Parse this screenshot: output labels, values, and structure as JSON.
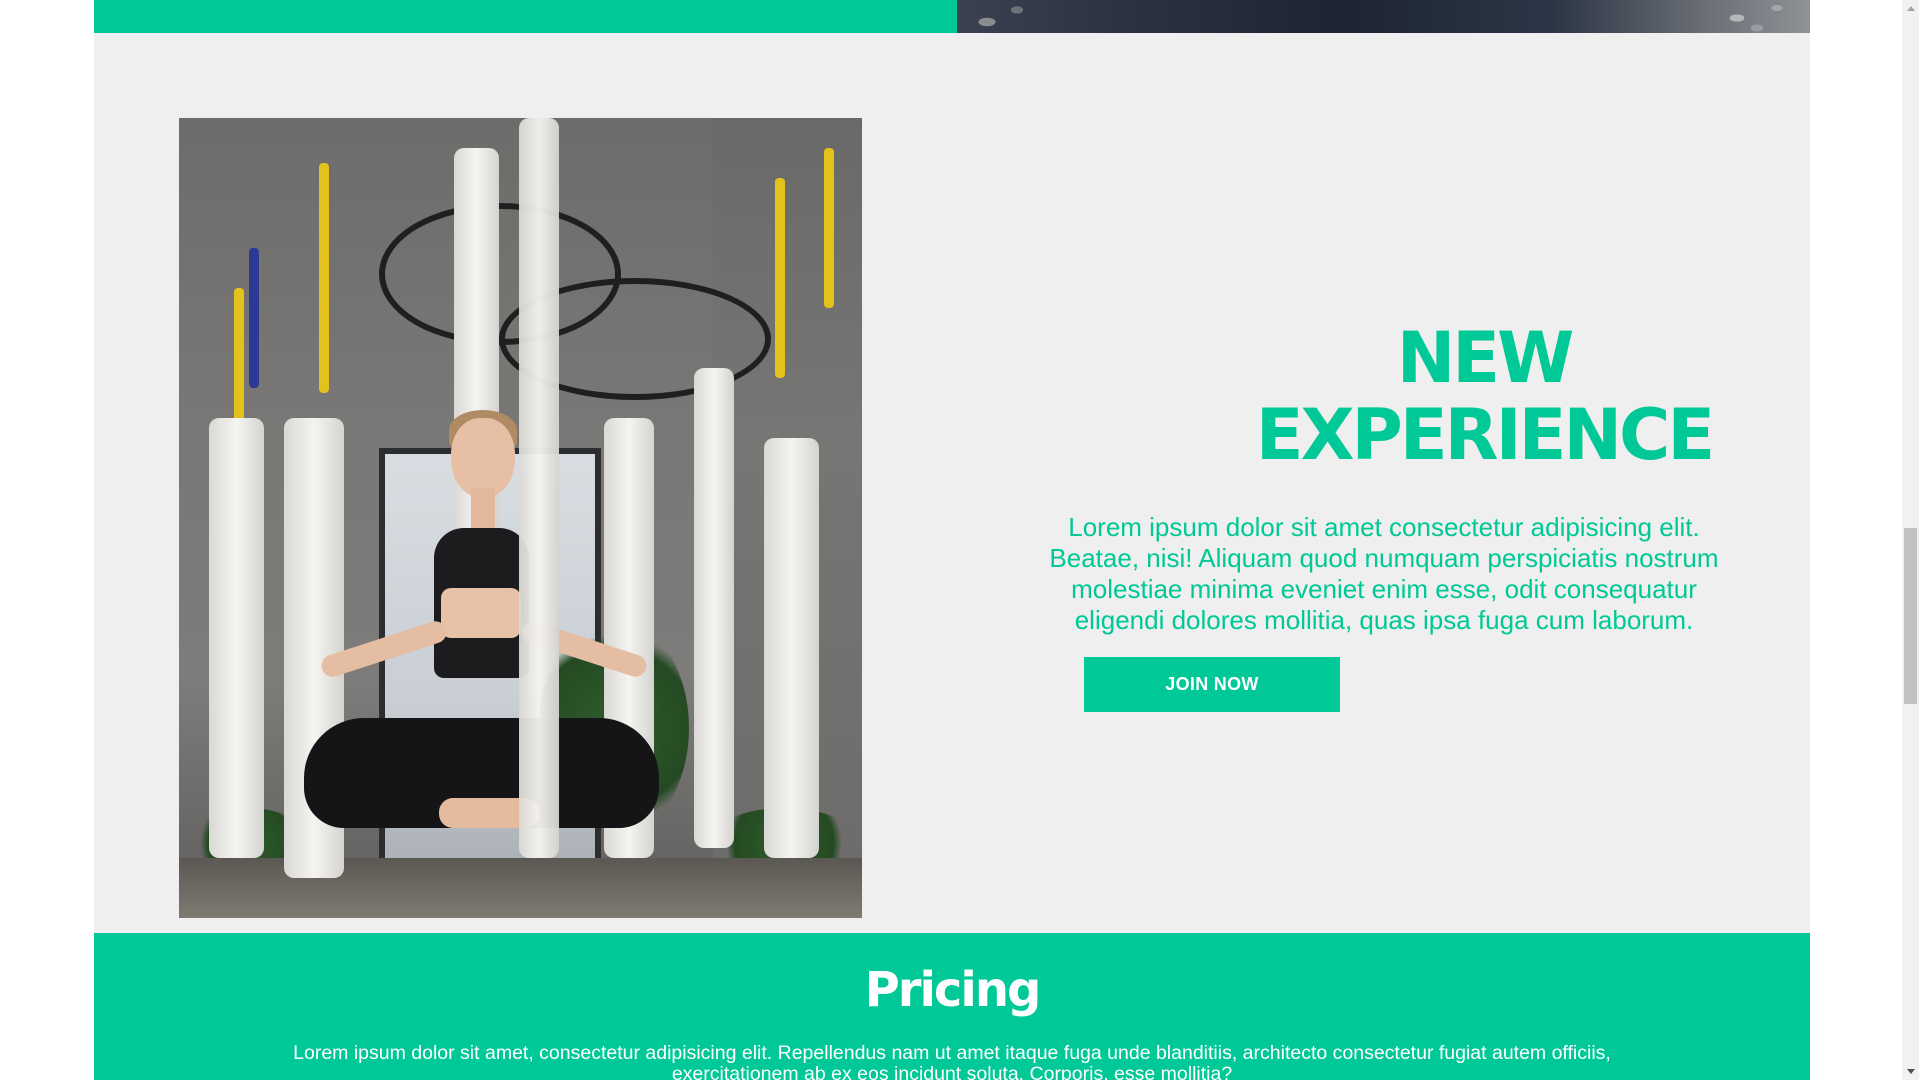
{
  "hero": {
    "title_line1": "NEW",
    "title_line2": "EXPERIENCE",
    "paragraph": "Lorem ipsum dolor sit amet consectetur adipisicing elit. Beatae, nisi! Aliquam quod numquam perspiciatis nostrum molestiae minima eveniet enim esse, odit consequatur eligendi dolores mollitia, quas ipsa fuga cum laborum.",
    "cta_label": "JOIN NOW"
  },
  "pricing": {
    "title": "Pricing",
    "paragraph": "Lorem ipsum dolor sit amet, consectetur adipisicing elit. Repellendus nam ut amet itaque fuga unde blanditiis, architecto consectetur fugiat autem officiis, exercitationem ab ex eos incidunt soluta. Corporis, esse mollitia?"
  },
  "colors": {
    "accent": "#00c896",
    "section_background": "#eeefee",
    "button_text": "#ffffff"
  },
  "icons": {
    "scroll_up": "triangle-up-icon",
    "scroll_down": "triangle-down-icon"
  }
}
